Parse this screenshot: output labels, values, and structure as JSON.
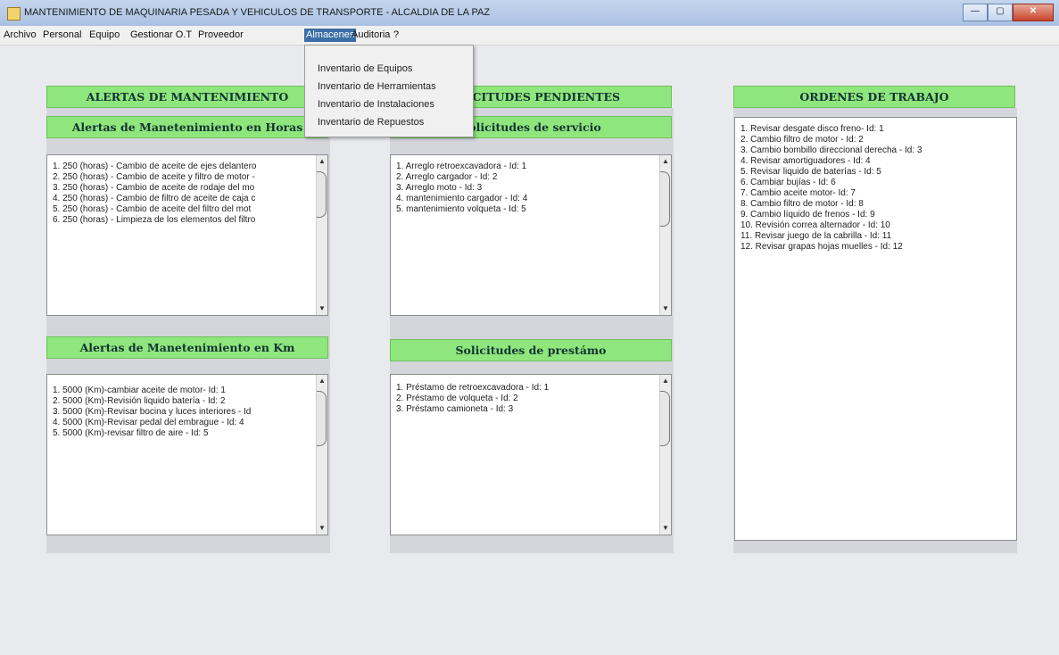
{
  "window": {
    "title": "MANTENIMIENTO DE MAQUINARIA PESADA Y VEHICULOS DE TRANSPORTE - ALCALDIA DE LA PAZ",
    "controls": {
      "minimize": "—",
      "maximize": "▢",
      "close": "✕"
    }
  },
  "menubar": {
    "items": [
      "Archivo",
      "Personal",
      "Equipo",
      "Gestionar O.T",
      "Proveedor",
      "Almacenes",
      "Auditoria",
      "?"
    ],
    "active": "Almacenes"
  },
  "dropdown": {
    "items": [
      "Inventario de Equipos",
      "Inventario de Herramientas",
      "Inventario de Instalaciones",
      "Inventario de Repuestos"
    ]
  },
  "alertas": {
    "title": "ALERTAS DE MANTENIMIENTO",
    "horas": {
      "title": "Alertas de Manetenimiento en Horas",
      "items": [
        "1. 250 (horas) - Cambio de aceite de ejes delantero",
        "2. 250 (horas) - Cambio de aceite y filtro de motor -",
        "3. 250 (horas) - Cambio de aceite de rodaje del mo",
        "4. 250 (horas) - Cambio de filtro de aceite de caja c",
        "5. 250 (horas) -  Cambio de aceite del filtro del mot",
        "6. 250 (horas) - Limpieza de los elementos del filtro"
      ]
    },
    "km": {
      "title": "Alertas de Manetenimiento en Km",
      "items": [
        "1. 5000 (Km)-cambiar aceite de motor- Id: 1",
        "2. 5000 (Km)-Revisión liquido batería - Id: 2",
        "3. 5000 (Km)-Revisar bocina y luces interiores - Id",
        "4. 5000 (Km)-Revisar pedal del embrague - Id: 4",
        "5. 5000 (Km)-revisar filtro de aire  - Id: 5"
      ]
    }
  },
  "solicitudes": {
    "title": "SOLICITUDES PENDIENTES",
    "servicio": {
      "title": "Solicitudes de servicio",
      "items": [
        "1. Arreglo retroexcavadora - Id: 1",
        "2. Arreglo cargador - Id: 2",
        "3. Arreglo moto - Id: 3",
        "4. mantenimiento cargador - Id: 4",
        "5. mantenimiento volqueta - Id: 5"
      ]
    },
    "prestamo": {
      "title": "Solicitudes de prestámo",
      "items": [
        "1. Préstamo de retroexcavadora - Id: 1",
        "2. Préstamo de volqueta - Id: 2",
        "3. Préstamo camioneta - Id: 3"
      ]
    }
  },
  "ordenes": {
    "title": "ORDENES DE TRABAJO",
    "items": [
      "1. Revisar desgate disco freno- Id: 1",
      "2. Cambio filtro de motor - Id: 2",
      "3. Cambio bombillo direccional derecha - Id: 3",
      "4. Revisar amortiguadores - Id: 4",
      "5. Revisar liquido de baterías - Id: 5",
      "6. Cambiar bujías - Id: 6",
      "7. Cambio aceite motor- Id: 7",
      "8. Cambio filtro de motor - Id: 8",
      "9. Cambio líquido de frenos - Id: 9",
      "10. Revisión correa alternador - Id: 10",
      "11. Revisar juego de la cabrilla - Id: 11",
      "12. Revisar grapas hojas muelles - Id: 12"
    ]
  }
}
